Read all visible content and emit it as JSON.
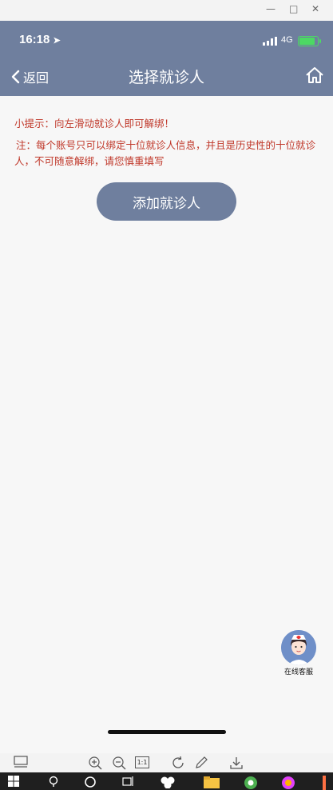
{
  "status_bar": {
    "time": "16:18",
    "network": "4G",
    "battery_level": 0.9
  },
  "nav": {
    "back_label": "返回",
    "title": "选择就诊人"
  },
  "content": {
    "tip": "小提示：向左滑动就诊人即可解绑！",
    "note": "注：每个账号只可以绑定十位就诊人信息，并且是历史性的十位就诊人，不可随意解绑，请您慎重填写",
    "add_button": "添加就诊人"
  },
  "service": {
    "label": "在线客服"
  },
  "viewer": {
    "actual_size": "1:1"
  },
  "colors": {
    "primary": "#6f7f9e",
    "warning_text": "#c0392b",
    "battery": "#4cd964"
  }
}
